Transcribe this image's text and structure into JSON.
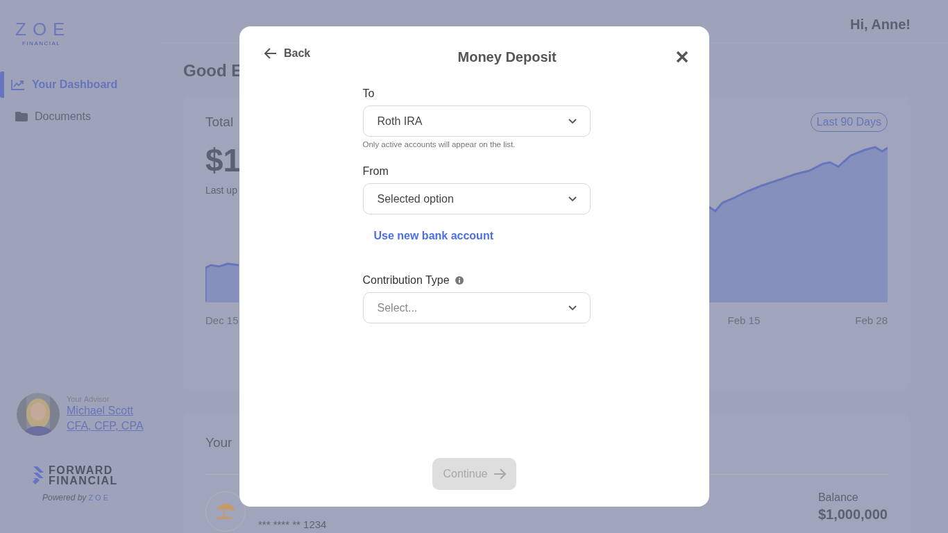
{
  "logo": {
    "name": "ZOE",
    "tagline": "FINANCIAL"
  },
  "sidebar": {
    "items": [
      {
        "label": "Your Dashboard",
        "kind": "chart",
        "selected": true
      },
      {
        "label": "Documents",
        "kind": "folder",
        "selected": false
      }
    ]
  },
  "advisor": {
    "caption": "Your Advisor",
    "name": "Michael Scott",
    "credentials": "CFA, CFP, CPA"
  },
  "partner": {
    "line1": "FORWARD",
    "line2": "FINANCIAL",
    "powered_by": "Powered by",
    "powered_logo": "ZOE"
  },
  "header": {
    "greeting": "Hi, Anne!"
  },
  "page_title": "Good E",
  "summary_card": {
    "title": "Total",
    "amount": "$1",
    "updated": "Last up",
    "range": "Last 90 Days",
    "x_labels": [
      "Dec 15",
      "Feb 15",
      "Feb 28"
    ]
  },
  "accounts_card": {
    "title": "Your",
    "account": {
      "number": "*** **** ** 1234",
      "balance_label": "Balance",
      "balance": "$1,000,000"
    }
  },
  "modal": {
    "back": "Back",
    "title": "Money Deposit",
    "fields": [
      {
        "label": "To",
        "value": "Roth IRA",
        "hint": "Only active accounts will appear on the list."
      },
      {
        "label": "From",
        "value": "Selected option",
        "link": "Use new bank account"
      },
      {
        "label": "Contribution Type",
        "placeholder": "Select...",
        "info": true
      }
    ],
    "continue": {
      "label": "Continue",
      "disabled": true
    }
  }
}
